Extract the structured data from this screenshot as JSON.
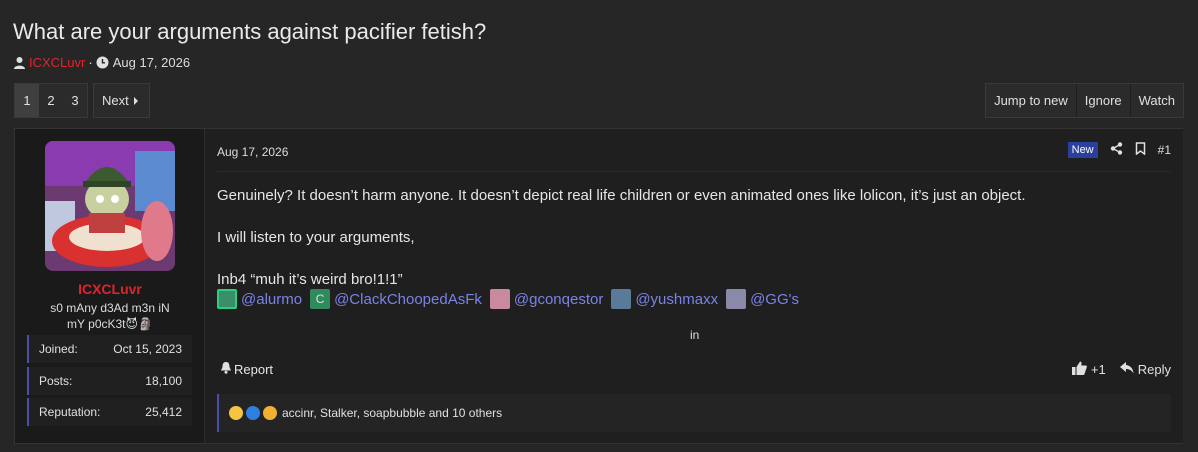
{
  "thread": {
    "title": "What are your arguments against pacifier fetish?",
    "author": "ICXCLuvr",
    "separator": "·",
    "date": "Aug 17, 2026"
  },
  "pagination": {
    "pages": [
      "1",
      "2",
      "3"
    ],
    "current": "1",
    "next_label": "Next"
  },
  "thread_actions": [
    "Jump to new",
    "Ignore",
    "Watch"
  ],
  "post": {
    "user": {
      "name": "ICXCLuvr",
      "title": "s0 mAny d3Ad m3n iN mY p0cK3t😈🗿",
      "stats": [
        {
          "label": "Joined:",
          "value": "Oct 15, 2023"
        },
        {
          "label": "Posts:",
          "value": "18,100"
        },
        {
          "label": "Reputation:",
          "value": "25,412"
        }
      ]
    },
    "date": "Aug 17, 2026",
    "badge": "New",
    "number": "#1",
    "lines": [
      "Genuinely? It doesn’t harm anyone. It doesn’t depict real life children or even animated ones like lolicon, it’s just an object.",
      "I will listen to your arguments,",
      "Inb4 “muh it’s weird bro!1!1”"
    ],
    "mentions": [
      {
        "name": "@alurmo",
        "avatar_color": "#3a8f6a"
      },
      {
        "name": "@ClackChoopedAsFk",
        "avatar_color": "#2f8a5c",
        "avatar_letter": "C"
      },
      {
        "name": "@gconqestor",
        "avatar_color": "#c98aa0"
      },
      {
        "name": "@yushmaxx",
        "avatar_color": "#5a7a9a"
      },
      {
        "name": "@GG's",
        "avatar_color": "#8a8aa8"
      }
    ],
    "in_text": "in",
    "report_label": "Report",
    "like_count": "+1",
    "reply_label": "Reply",
    "reactions_text": "accinr, Stalker, soapbubble and 10 others"
  }
}
